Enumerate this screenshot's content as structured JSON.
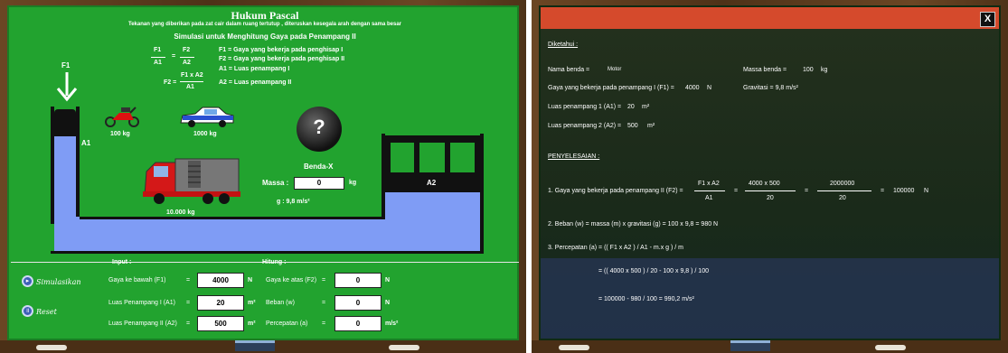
{
  "left": {
    "title": "Hukum Pascal",
    "description": "Tekanan yang diberikan pada zat cair dalam ruang tertutup , diteruskan kesegala arah dengan sama besar",
    "subtitle": "Simulasi untuk Menghitung Gaya pada Penampang II",
    "formula": {
      "f1": "F1",
      "a1": "A1",
      "f2": "F2",
      "a2": "A2",
      "eq": "=",
      "f2_eq": "F2 =",
      "num2": "F1 x A2",
      "den2": "A1"
    },
    "legend": [
      "F1 = Gaya yang bekerja pada penghisap I",
      "F2 = Gaya yang bekerja pada penghisap II",
      "A1 = Luas penampang I",
      "A2 = Luas penampang II"
    ],
    "f1_label": "F1",
    "a1_label": "A1",
    "a2_label": "A2",
    "motor_mass": "100 kg",
    "car_mass": "1000 kg",
    "truck_mass": "10.000 kg",
    "mystery_symbol": "?",
    "benda_label": "Benda-X",
    "massa_label": "Massa :",
    "massa_value": "0",
    "massa_unit": "kg",
    "gravity": "g : 9,8 m/s²",
    "buttons": {
      "simulate": "Simulasikan",
      "reset": "Reset"
    },
    "input": {
      "heading": "Input :",
      "rows": [
        {
          "label": "Gaya ke bawah (F1)",
          "eq": "=",
          "value": "4000",
          "unit": "N"
        },
        {
          "label": "Luas Penampang I (A1)",
          "eq": "=",
          "value": "20",
          "unit": "m²"
        },
        {
          "label": "Luas Penampang II (A2)",
          "eq": "=",
          "value": "500",
          "unit": "m²"
        }
      ]
    },
    "output": {
      "heading": "Hitung :",
      "rows": [
        {
          "label": "Gaya ke atas (F2)",
          "eq": "=",
          "value": "0",
          "unit": "N"
        },
        {
          "label": "Beban (w)",
          "eq": "=",
          "value": "0",
          "unit": "N"
        },
        {
          "label": "Percepatan (a)",
          "eq": "=",
          "value": "0",
          "unit": "m/s²"
        }
      ]
    }
  },
  "right": {
    "close": "X",
    "known_heading": "Diketahui :",
    "nama_label": "Nama benda =",
    "nama_value": "Motor",
    "massa_label": "Massa benda =",
    "massa_value": "100",
    "massa_unit": "kg",
    "f1_label": "Gaya yang bekerja pada penampang I (F1) =",
    "f1_value": "4000",
    "f1_unit": "N",
    "gravitasi": "Gravitasi = 9,8 m/s²",
    "a1_label": "Luas penampang 1 (A1) =",
    "a1_value": "20",
    "a1_unit": "m²",
    "a2_label": "Luas penampang 2 (A2) =",
    "a2_value": "500",
    "a2_unit": "m²",
    "solution_heading": "PENYELESAIAN :",
    "step1": {
      "label": "1. Gaya yang bekerja pada penampang II (F2) =",
      "n1": "F1 x A2",
      "d1": "A1",
      "eq1": "=",
      "n2": "4000 x 500",
      "d2": "20",
      "eq2": "=",
      "n3": "2000000",
      "d3": "20",
      "eq3": "=",
      "result": "100000",
      "unit": "N"
    },
    "step2": "2. Beban (w) = massa (m) x gravitasi (g) = 100 x 9,8 = 980 N",
    "step3": "3. Percepatan (a) = (( F1 x A2 ) / A1 - m.x g ) / m",
    "step3_line2": "= (( 4000 x 500 ) / 20 - 100 x 9,8 ) / 100",
    "step3_line3": "= 100000 - 980 / 100 = 990,2 m/s²"
  }
}
